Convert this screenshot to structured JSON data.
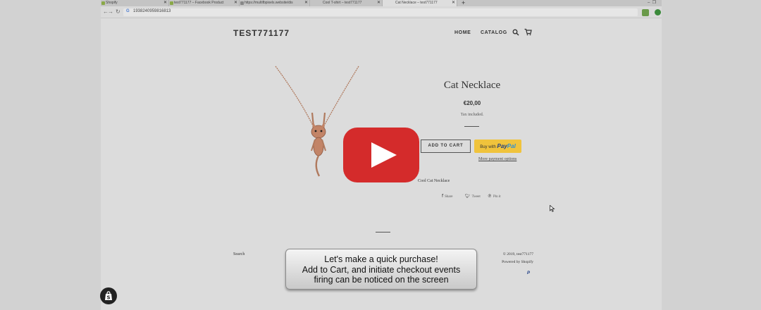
{
  "browser": {
    "tabs": [
      {
        "label": "Shopify",
        "active": false
      },
      {
        "label": "test771177 – Facebook Product",
        "active": false
      },
      {
        "label": "https://multifbpixels.website/dis",
        "active": false
      },
      {
        "label": "Cool T-shirt – test771177",
        "active": false
      },
      {
        "label": "Cat Necklace – test771177",
        "active": true
      }
    ],
    "url": "1938240959816813"
  },
  "store": {
    "logo": "TEST771177",
    "nav": {
      "home": "HOME",
      "catalog": "CATALOG"
    }
  },
  "product": {
    "title": "Cat Necklace",
    "price": "€20,00",
    "tax_note": "Tax included.",
    "add_to_cart": "ADD TO CART",
    "paypal_prefix": "Buy with",
    "paypal_brand_a": "Pay",
    "paypal_brand_b": "Pal",
    "more_payment": "More payment options",
    "description": "Cool Cat Necklace",
    "share": {
      "share": "Share",
      "tweet": "Tweet",
      "pin": "Pin it"
    }
  },
  "footer": {
    "search": "Search",
    "copyright": "© 2019, test771177",
    "powered": "Powered by Shopify"
  },
  "callout": {
    "line1": "Let's make a quick purchase!",
    "line2": "Add to Cart, and initiate checkout events",
    "line3": "firing can be noticed on the screen"
  },
  "colors": {
    "youtube_red": "#d42b2b",
    "paypal_yellow": "#f0c33c",
    "background": "#d2d2d2"
  }
}
